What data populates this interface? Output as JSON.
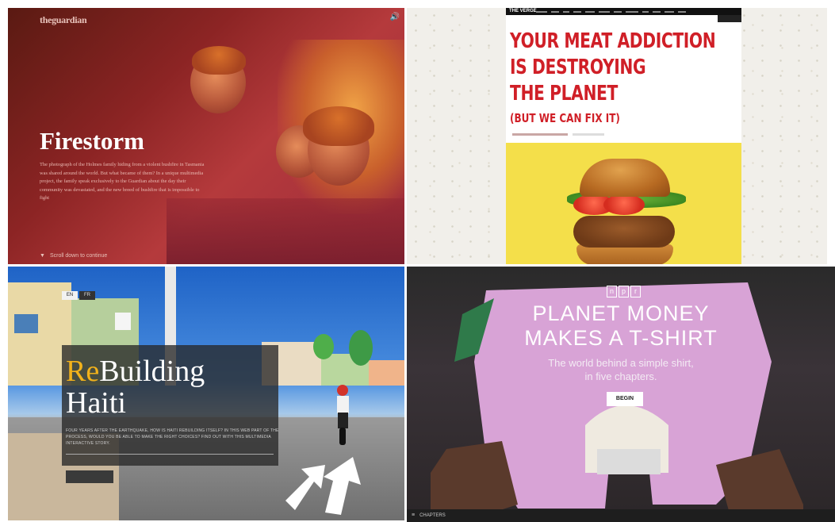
{
  "guardian": {
    "logo": "theguardian",
    "sound_icon": "🔊",
    "title": "Firestorm",
    "body": "The photograph of the Holmes family hiding from a violent bushfire in Tasmania was shared around the world. But what became of them? In a unique multimedia project, the family speak exclusively to the Guardian about the day their community was devastated, and the new breed of bushfire that is impossible to fight",
    "scroll_icon": "▼",
    "scroll_text": "Scroll down to continue"
  },
  "verge": {
    "logo": "THE VERGE",
    "headline_lines": [
      "YOUR MEAT ADDICTION",
      "IS DESTROYING",
      "THE PLANET"
    ],
    "subhead": "(BUT WE CAN FIX IT)"
  },
  "haiti": {
    "lang_en": "EN",
    "lang_fr": "FR",
    "title_re": "Re",
    "title_rest": "Building",
    "title_line2": "Haiti",
    "body": "FOUR YEARS AFTER THE EARTHQUAKE, HOW IS HAITI REBUILDING ITSELF? IN THIS WEB PART OF THE PROCESS, WOULD YOU BE ABLE TO MAKE THE RIGHT CHOICES? FIND OUT WITH THIS MULTIMEDIA INTERACTIVE STORY."
  },
  "npr": {
    "logo_letters": [
      "n",
      "p",
      "r"
    ],
    "title_line1": "PLANET MONEY",
    "title_line2": "MAKES A T-SHIRT",
    "subtitle_line1": "The world behind a simple shirt,",
    "subtitle_line2": "in five chapters.",
    "begin_label": "BEGIN",
    "chapters_icon": "≡",
    "chapters_label": "CHAPTERS"
  },
  "colors": {
    "verge_red": "#d01f27",
    "haiti_accent": "#f2b21b",
    "npr_pink": "#d8a3d6"
  }
}
